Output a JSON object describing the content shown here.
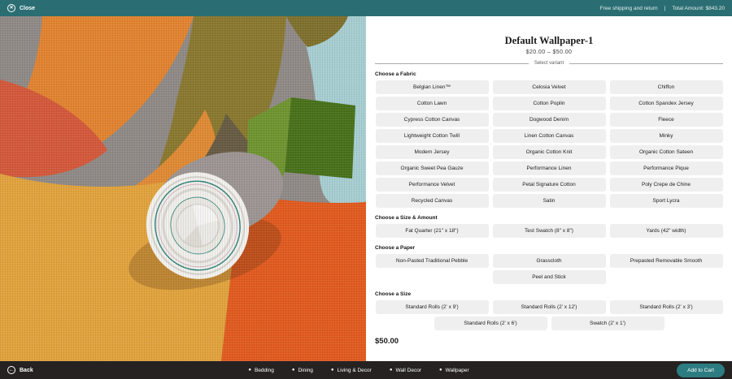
{
  "topbar": {
    "close": "Close",
    "shipping_note": "Free shipping and return",
    "separator": "|",
    "total_amount": "Total Amount: $843.20"
  },
  "image": {
    "description": "Rolled wallpaper lying on colorful abstract woven fabric (orange, olive, teal, green, amber)"
  },
  "product": {
    "title": "Default Wallpaper-1",
    "price_range": "$20.00  –  $50.00",
    "variant_hint": "Select variant",
    "current_price": "$50.00"
  },
  "sections": [
    {
      "label": "Choose a Fabric",
      "options": [
        "Belgian Linen™",
        "Celosia Velvet",
        "Chiffon",
        "Cotton Lawn",
        "Cotton Poplin",
        "Cotton Spandex Jersey",
        "Cypress Cotton Canvas",
        "Dogwood Denim",
        "Fleece",
        "Lightweight Cotton Twill",
        "Linen Cotton Canvas",
        "Minky",
        "Modern Jersey",
        "Organic Cotton Knit",
        "Organic Cotton Sateen",
        "Organic Sweet Pea Gauze",
        "Performance Linen",
        "Performance Pique",
        "Performance Velvet",
        "Petal Signature Cotton",
        "Poly Crepe de Chine",
        "Recycled Canvas",
        "Satin",
        "Sport Lycra"
      ]
    },
    {
      "label": "Choose a Size & Amount",
      "options": [
        "Fat Quarter (21\" x 18\")",
        "Test Swatch (8\" x 8\")",
        "Yards (42\" width)"
      ]
    },
    {
      "label": "Choose a Paper",
      "options": [
        "Non-Pasted Traditional Pebble",
        "Grasscloth",
        "Prepasted Removable Smooth",
        "Peel and Stick"
      ]
    },
    {
      "label": "Choose a Size",
      "options": [
        "Standard Rolls (2' x 9')",
        "Standard Rolls (2' x 12')",
        "Standard Rolls (2' x 3')",
        "Standard Rolls (2' x 6')",
        "Swatch (2' x 1')"
      ]
    }
  ],
  "bottombar": {
    "back": "Back",
    "categories": [
      "Bedding",
      "Dining",
      "Living & Decor",
      "Wall Decor",
      "Wallpaper"
    ],
    "add_to_cart": "Add to Cart"
  },
  "icons": {
    "close_glyph": "✕",
    "back_glyph": "←",
    "dot_glyph": "●"
  },
  "colors": {
    "topbar": "#2a6e73",
    "accent": "#2d7c82",
    "bottombar": "#262222",
    "option_bg": "#efeff0"
  }
}
